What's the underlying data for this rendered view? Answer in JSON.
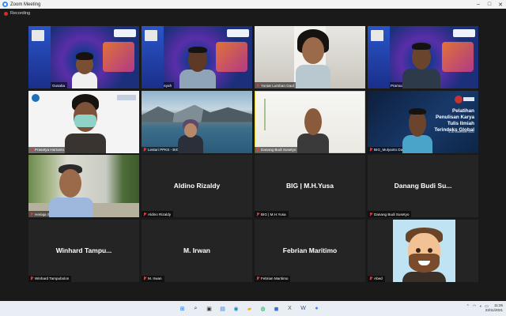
{
  "window": {
    "title": "Zoom Meeting",
    "controls": {
      "minimize": "–",
      "maximize": "□",
      "close": "✕"
    }
  },
  "recording": {
    "label": "Recording"
  },
  "participants": [
    {
      "name": "Alexander Gusaba",
      "video": "webinar",
      "muted": true
    },
    {
      "name": "Edy Irwansyah",
      "video": "webinar",
      "muted": true
    },
    {
      "name": "Yuniar Lumban Gaol",
      "video": "room",
      "muted": true
    },
    {
      "name": "Fabian S. Pramudya",
      "video": "webinar",
      "muted": true
    },
    {
      "name": "Prasetya Hartanto - PPKS BIG",
      "video": "white",
      "muted": true
    },
    {
      "name": "Lestari PPKS - BIG",
      "video": "lake",
      "muted": true
    },
    {
      "name": "Danang Budi Susetyo",
      "video": "active",
      "muted": true,
      "active": true
    },
    {
      "name": "BIG_Mulyanto Darmawan_BIG",
      "video": "slide",
      "muted": true
    },
    {
      "name": "Heriaja Suryanto",
      "video": "garden",
      "muted": true
    },
    {
      "name": "Aldino Rizaldy",
      "display": "Aldino Rizaldy",
      "video": "off",
      "muted": true
    },
    {
      "name": "BIG | M.H.Yusa",
      "display": "BIG | M.H.Yusa",
      "video": "off",
      "muted": true
    },
    {
      "name": "Danang Budi Susetyo",
      "display": "Danang Budi Su...",
      "video": "off",
      "muted": true
    },
    {
      "name": "Winhard Tampubolon",
      "display": "Winhard Tampu...",
      "video": "off",
      "muted": true
    },
    {
      "name": "M. Irwan",
      "display": "M. Irwan",
      "video": "off",
      "muted": true
    },
    {
      "name": "Febrian Maritimo",
      "display": "Febrian Maritimo",
      "video": "off",
      "muted": true
    },
    {
      "name": "Abed",
      "video": "avatar",
      "muted": true
    }
  ],
  "slide": {
    "title_lines": [
      "Pelatihan",
      "Penulisan Karya",
      "Tulis Ilmiah",
      "Terindeks Global"
    ],
    "date": "4-16 November 2021"
  },
  "taskbar": {
    "apps": [
      {
        "icon": "windows-start-icon",
        "glyph": "⊞",
        "color": "#1a73e8"
      },
      {
        "icon": "search-icon",
        "glyph": "⌕",
        "color": "#333333"
      },
      {
        "icon": "task-view-icon",
        "glyph": "▣",
        "color": "#333333"
      },
      {
        "icon": "widgets-icon",
        "glyph": "▤",
        "color": "#2b7de9"
      },
      {
        "icon": "edge-icon",
        "glyph": "◉",
        "color": "#0f8fb8"
      },
      {
        "icon": "file-explorer-icon",
        "glyph": "▰",
        "color": "#e7b23b"
      },
      {
        "icon": "chrome-icon",
        "glyph": "◍",
        "color": "#1aa260"
      },
      {
        "icon": "store-icon",
        "glyph": "◼",
        "color": "#3a6fd8"
      },
      {
        "icon": "excel-icon",
        "glyph": "X",
        "color": "#1e7145"
      },
      {
        "icon": "word-icon",
        "glyph": "W",
        "color": "#2b5797"
      },
      {
        "icon": "zoom-icon",
        "glyph": "●",
        "color": "#2d8cff"
      }
    ],
    "clock": {
      "time": "11:25",
      "date": "23/11/2021"
    }
  },
  "colors": {
    "active_speaker": "#e8d53a",
    "muted_mic": "#e03b3b",
    "zoom_blue": "#2d8cff",
    "recording_dot": "#e02828"
  }
}
